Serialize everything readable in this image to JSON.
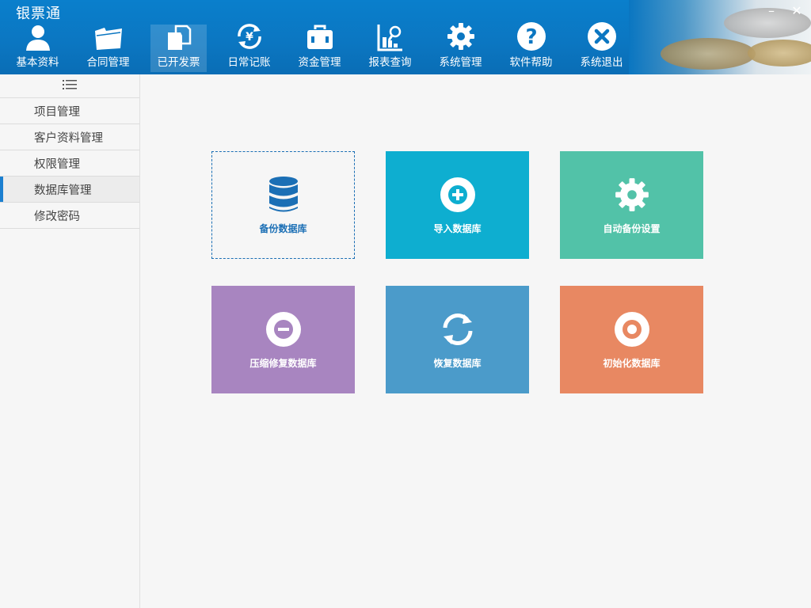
{
  "app": {
    "title": "银票通",
    "minimize": "–",
    "close": "✕"
  },
  "nav": [
    {
      "label": "基本资料",
      "icon": "user-icon"
    },
    {
      "label": "合同管理",
      "icon": "folder-icon"
    },
    {
      "label": "已开发票",
      "icon": "documents-icon",
      "active": true
    },
    {
      "label": "日常记账",
      "icon": "currency-refresh-icon"
    },
    {
      "label": "资金管理",
      "icon": "briefcase-icon"
    },
    {
      "label": "报表查询",
      "icon": "chart-search-icon"
    },
    {
      "label": "系统管理",
      "icon": "gear-icon"
    },
    {
      "label": "软件帮助",
      "icon": "help-icon"
    },
    {
      "label": "系统退出",
      "icon": "exit-icon"
    }
  ],
  "sidebar": {
    "toggle_icon": "list-icon",
    "items": [
      {
        "label": "项目管理"
      },
      {
        "label": "客户资料管理"
      },
      {
        "label": "权限管理"
      },
      {
        "label": "数据库管理",
        "active": true
      },
      {
        "label": "修改密码"
      }
    ]
  },
  "tiles": [
    {
      "label": "备份数据库",
      "icon": "database-icon",
      "color": "#1b6fb5"
    },
    {
      "label": "导入数据库",
      "icon": "plus-circle-icon",
      "color": "#0eaed0"
    },
    {
      "label": "自动备份设置",
      "icon": "gear-icon",
      "color": "#52c2a8"
    },
    {
      "label": "压缩修复数据库",
      "icon": "minus-circle-icon",
      "color": "#a885c0"
    },
    {
      "label": "恢复数据库",
      "icon": "refresh-icon",
      "color": "#4b9bca"
    },
    {
      "label": "初始化数据库",
      "icon": "ring-icon",
      "color": "#e88862"
    }
  ]
}
